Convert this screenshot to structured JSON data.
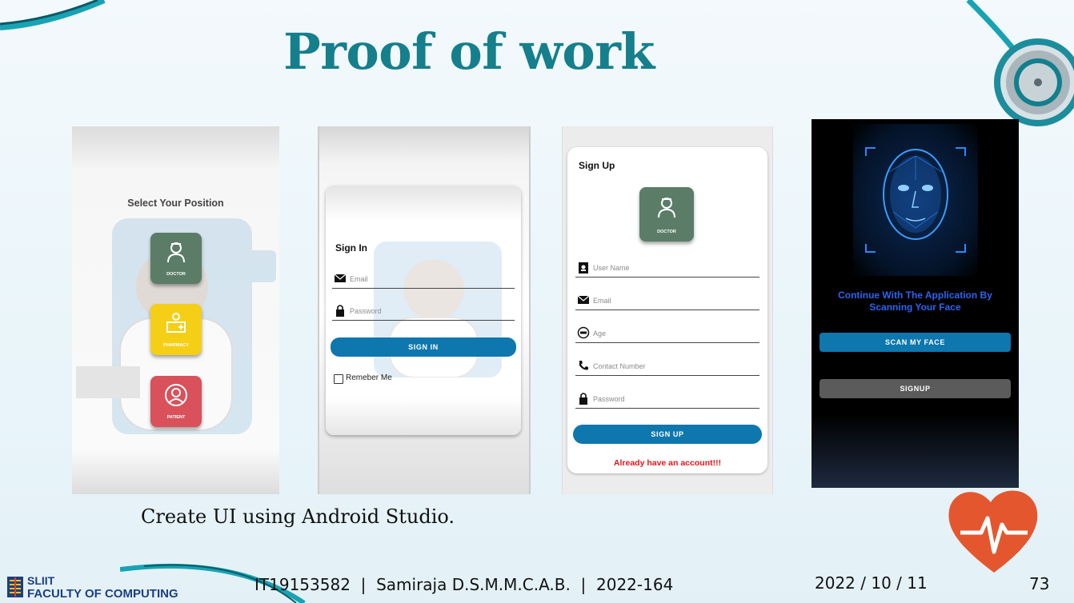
{
  "slide": {
    "title": "Proof of work",
    "caption": "Create UI using Android Studio.",
    "footer_id": "IT19153582  |  Samiraja D.S.M.M.C.A.B.  |  2022-164",
    "footer_date": "2022 / 10 / 11",
    "page_number": "73",
    "logo_line1": "SLIIT",
    "logo_line2": "FACULTY OF COMPUTING"
  },
  "colors": {
    "accent": "#157f8c",
    "primary_button": "#0e77ae",
    "doctor": "#5b7d67",
    "pharmacy": "#f5cf16",
    "patient": "#d9515a"
  },
  "screens": {
    "position": {
      "heading": "Select Your  Position",
      "roles": [
        {
          "label": "DOCTOR",
          "icon": "doctor-icon"
        },
        {
          "label": "PHARMACY",
          "icon": "pharmacy-icon"
        },
        {
          "label": "PATIENT",
          "icon": "patient-icon"
        }
      ]
    },
    "signin": {
      "heading": "Sign In",
      "email_placeholder": "Email",
      "password_placeholder": "Password",
      "button": "SIGN IN",
      "remember": "Remeber Me"
    },
    "signup": {
      "heading": "Sign Up",
      "role_label": "DOCTOR",
      "fields": [
        "User Name",
        "Email",
        "Age",
        "Contact Number",
        "Password"
      ],
      "button": "SIGN UP",
      "login_link": "Already have an account!!!"
    },
    "face": {
      "message_line1": "Continue With The Application By",
      "message_line2": "Scanning Your Face",
      "scan_button": "SCAN MY FACE",
      "signup_button": "SIGNUP"
    }
  }
}
